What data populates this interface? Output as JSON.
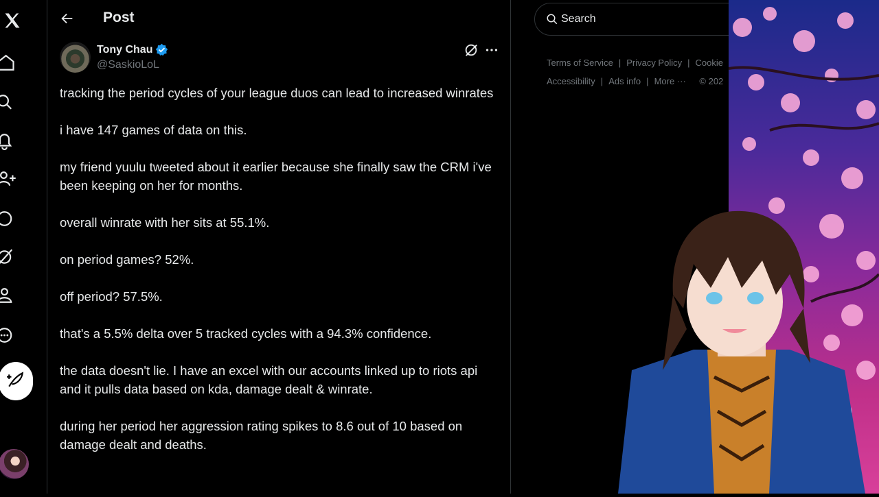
{
  "nav": {
    "items": [
      {
        "icon": "x-logo-icon"
      },
      {
        "icon": "home-icon"
      },
      {
        "icon": "search-icon"
      },
      {
        "icon": "notifications-icon"
      },
      {
        "icon": "follow-icon"
      },
      {
        "icon": "grok-icon"
      },
      {
        "icon": "communities-icon"
      },
      {
        "icon": "profile-icon"
      },
      {
        "icon": "more-icon"
      }
    ],
    "post_button_icon": "compose-icon"
  },
  "header": {
    "title": "Post"
  },
  "tweet": {
    "author_name": "Tony Chau",
    "author_handle": "@SaskioLoL",
    "verified": true,
    "paragraphs": [
      "tracking the period cycles of your league duos can lead to increased winrates",
      "i have 147 games of data on this.",
      "my friend yuulu tweeted about it earlier because she finally saw the CRM i've been keeping on her for months.",
      "overall winrate with her sits at 55.1%.",
      "on period games? 52%.",
      "off period? 57.5%.",
      "that's a 5.5% delta over 5 tracked cycles with a 94.3% confidence.",
      "the data doesn't lie. I have an excel with our accounts linked up to riots api and it pulls data based on kda, damage dealt & winrate.",
      "during her period her aggression rating spikes to 8.6 out of 10 based on damage dealt and deaths."
    ]
  },
  "search": {
    "placeholder": "Search"
  },
  "footer": {
    "links": [
      "Terms of Service",
      "Privacy Policy",
      "Cookie",
      "Accessibility",
      "Ads info",
      "More ···",
      "© 202"
    ]
  },
  "colors": {
    "accent": "#1d9bf0",
    "text": "#e7e9ea",
    "muted": "#71767b",
    "border": "#2f3336"
  }
}
